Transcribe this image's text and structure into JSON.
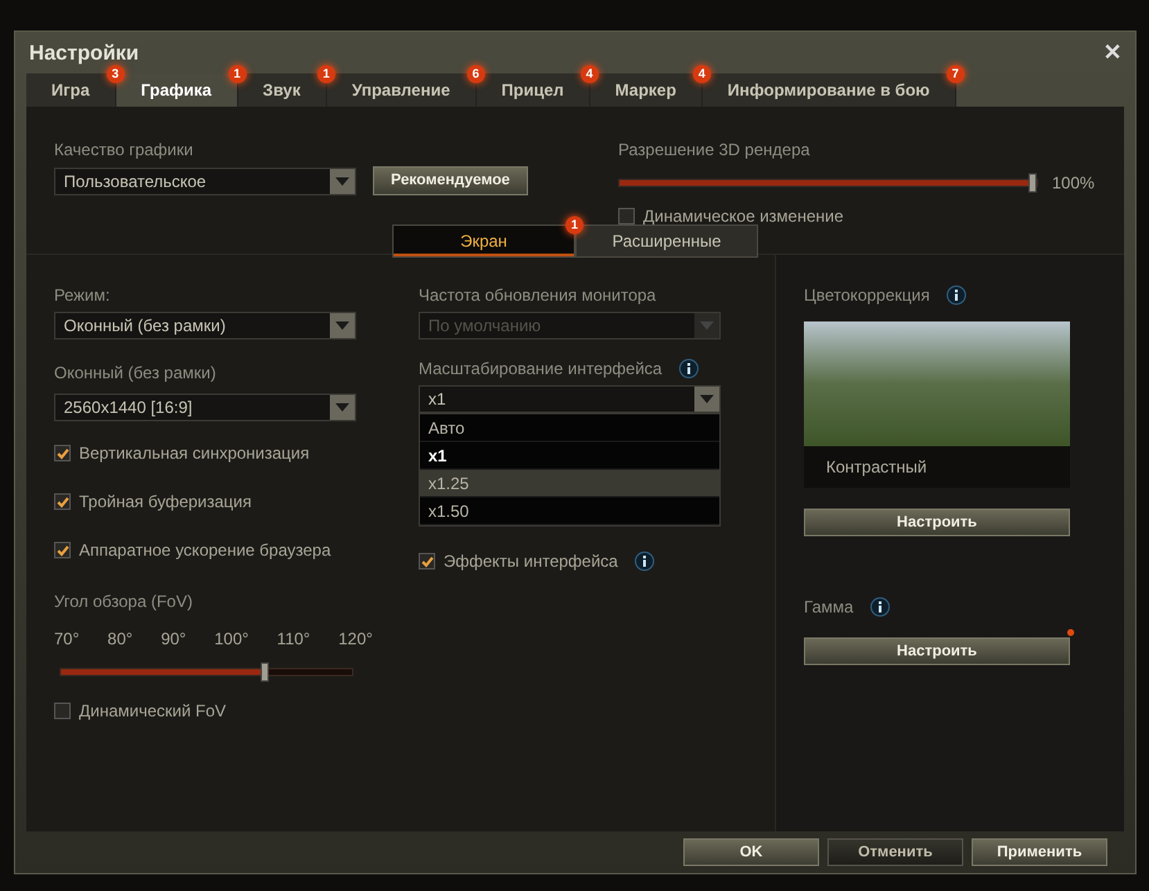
{
  "window": {
    "title": "Настройки",
    "close": "✕"
  },
  "tabs": [
    {
      "label": "Игра",
      "badge": "3",
      "selected": false
    },
    {
      "label": "Графика",
      "badge": "1",
      "selected": true
    },
    {
      "label": "Звук",
      "badge": "1",
      "selected": false
    },
    {
      "label": "Управление",
      "badge": "6",
      "selected": false
    },
    {
      "label": "Прицел",
      "badge": "4",
      "selected": false
    },
    {
      "label": "Маркер",
      "badge": "4",
      "selected": false
    },
    {
      "label": "Информирование в бою",
      "badge": "7",
      "selected": false
    }
  ],
  "quality": {
    "label": "Качество графики",
    "value": "Пользовательское",
    "button": "Рекомендуемое"
  },
  "render": {
    "label": "Разрешение 3D рендера",
    "level": 0.99,
    "reading": "100%",
    "dynamic": {
      "label": "Динамическое изменение",
      "checked": false
    }
  },
  "subtabs": [
    {
      "label": "Экран",
      "badge": "1",
      "selected": true
    },
    {
      "label": "Расширенные",
      "selected": false
    }
  ],
  "left": {
    "mode": {
      "label": "Режим:",
      "value": "Оконный (без рамки)"
    },
    "resolution": {
      "label": "Оконный (без рамки)",
      "value": "2560x1440 [16:9]"
    },
    "checkboxes": [
      {
        "label": "Вертикальная синхронизация",
        "checked": true
      },
      {
        "label": "Тройная буферизация",
        "checked": true
      },
      {
        "label": "Аппаратное ускорение браузера",
        "checked": true
      }
    ],
    "fov": {
      "label": "Угол обзора (FoV)",
      "ticks": [
        "70°",
        "80°",
        "90°",
        "100°",
        "110°",
        "120°"
      ],
      "level": 0.7
    },
    "dynamic_fov": {
      "label": "Динамический FoV",
      "checked": false
    }
  },
  "middle": {
    "refresh": {
      "label": "Частота обновления монитора",
      "value": "По умолчанию",
      "disabled": true
    },
    "scale": {
      "label": "Масштабирование интерфейса",
      "value": "x1",
      "expanded": true,
      "options": [
        {
          "label": "Авто",
          "selected": false,
          "hovered": false
        },
        {
          "label": "x1",
          "selected": true,
          "hovered": false
        },
        {
          "label": "x1.25",
          "selected": false,
          "hovered": true
        },
        {
          "label": "x1.50",
          "selected": false,
          "hovered": false
        }
      ]
    },
    "effects": {
      "label": "Эффекты интерфейса",
      "checked": true
    }
  },
  "right": {
    "color_correction": {
      "label": "Цветокоррекция",
      "caption": "Контрастный",
      "button": "Настроить"
    },
    "gamma": {
      "label": "Гамма",
      "button": "Настроить",
      "notification": true
    }
  },
  "footer": [
    {
      "label": "OK",
      "kind": "primary"
    },
    {
      "label": "Отменить",
      "kind": "dark"
    },
    {
      "label": "Применить",
      "kind": "primary"
    }
  ]
}
